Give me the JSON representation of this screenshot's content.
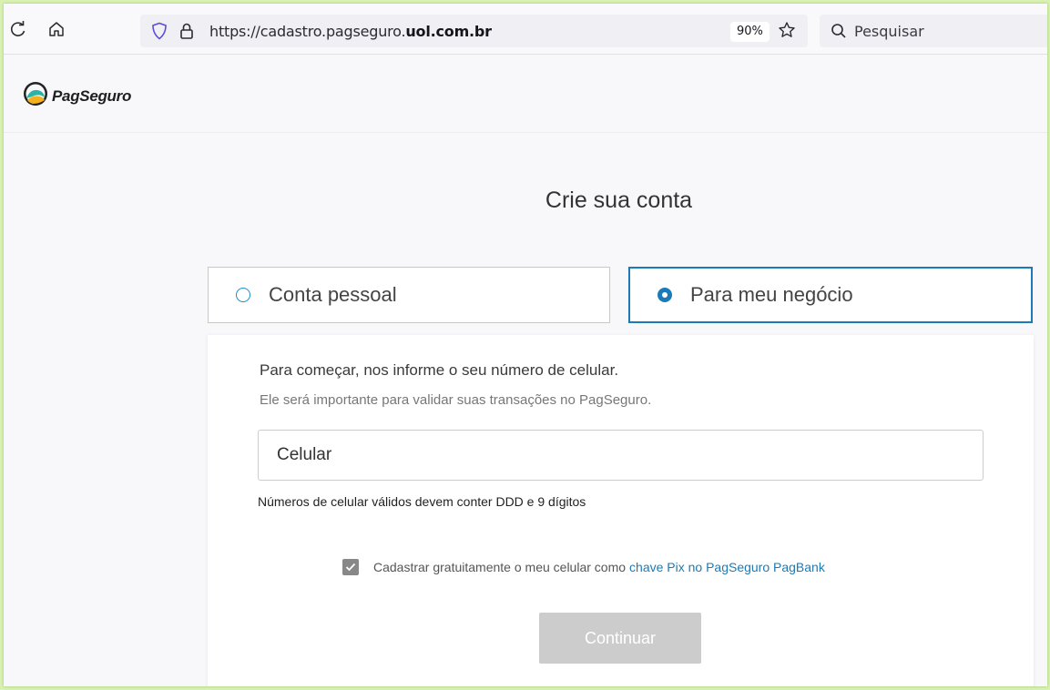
{
  "browser": {
    "url_prefix": "https://cadastro.pagseguro.",
    "url_domain": "uol.com.br",
    "zoom": "90%",
    "search_placeholder": "Pesquisar"
  },
  "header": {
    "logo_text": "PagSeguro"
  },
  "signup": {
    "title": "Crie sua conta",
    "options": [
      {
        "label": "Conta pessoal",
        "selected": false
      },
      {
        "label": "Para meu negócio",
        "selected": true
      }
    ],
    "intro": "Para começar, nos informe o seu número de celular.",
    "sub": "Ele será importante para validar suas transações no PagSeguro.",
    "phone_placeholder": "Celular",
    "phone_hint": "Números de celular válidos devem conter DDD e 9 dígitos",
    "pix_text": "Cadastrar gratuitamente o meu celular como",
    "pix_link": "chave Pix no PagSeguro PagBank",
    "pix_checked": true,
    "continue_label": "Continuar"
  },
  "colors": {
    "accent": "#1a7bb8",
    "button_disabled": "#cccccc",
    "frame_border": "#d9f2b4"
  }
}
